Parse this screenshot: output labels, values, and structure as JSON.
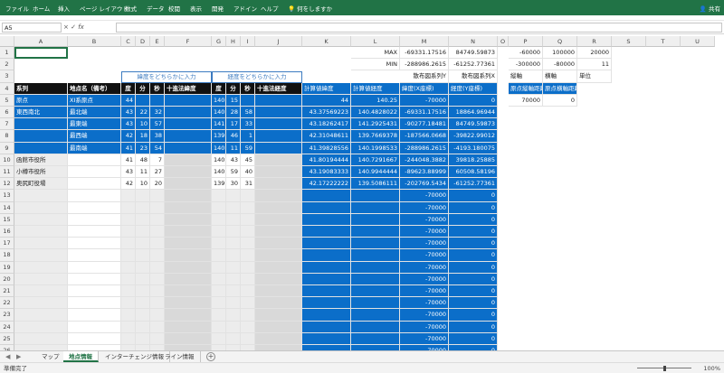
{
  "ribbon": {
    "tabs": [
      "ファイル",
      "ホーム",
      "挿入",
      "ページ レイアウト",
      "数式",
      "データ",
      "校閲",
      "表示",
      "開発",
      "アドイン",
      "ヘルプ"
    ],
    "help_text": "何をしますか",
    "share": "共有"
  },
  "formula_bar": {
    "name_box": "A5",
    "fx": "fx",
    "value": ""
  },
  "columns": [
    "A",
    "B",
    "C",
    "D",
    "E",
    "F",
    "G",
    "H",
    "I",
    "J",
    "K",
    "L",
    "M",
    "N",
    "O",
    "P",
    "Q",
    "R",
    "S",
    "T",
    "U"
  ],
  "rows": [
    "1",
    "2",
    "3",
    "4",
    "5",
    "6",
    "7",
    "8",
    "9",
    "10",
    "11",
    "12",
    "13",
    "14",
    "15",
    "16",
    "17",
    "18",
    "19",
    "20",
    "21",
    "22",
    "23",
    "24",
    "25",
    "26",
    "27"
  ],
  "labels": {
    "lat_input": "緯度をどちらかに入力",
    "lon_input": "経度をどちらかに入力",
    "max": "MAX",
    "min": "MIN",
    "y_label": "散布図系列Y",
    "x_label": "散布図系列X",
    "vertical_axis": "縦軸",
    "horizontal_axis": "横軸",
    "unit": "単位"
  },
  "summary": {
    "max_m": "-69331.17516",
    "max_n": "84749.59873",
    "min_m": "-288986.2615",
    "min_n": "-61252.77361",
    "p1": "-60000",
    "q1": "100000",
    "r1": "20000",
    "p2": "-300000",
    "q2": "-80000",
    "r2": "11"
  },
  "headers": [
    "系列",
    "地点名（備考）",
    "度",
    "分",
    "秒",
    "十進法緯度",
    "度",
    "分",
    "秒",
    "十進法経度",
    "計算値緯度",
    "計算値経度",
    "緯度(X座標)",
    "経度(Y座標)",
    "原点縦軸距離",
    "原点横軸距離"
  ],
  "origin_values": {
    "p": "70000",
    "q": "0"
  },
  "data_rows": [
    {
      "a": "原点",
      "b": "XI系原点",
      "c": "44",
      "d": "",
      "e": "",
      "f": "",
      "g": "140",
      "h": "15",
      "i": "",
      "j": "",
      "k": "44",
      "l": "140.25",
      "m": "-70000",
      "n": "0"
    },
    {
      "a": "東西南北",
      "b": "最北端",
      "c": "43",
      "d": "22",
      "e": "32",
      "f": "",
      "g": "140",
      "h": "28",
      "i": "58",
      "j": "",
      "k": "43.37569223",
      "l": "140.4828022",
      "m": "-69331.17516",
      "n": "18864.96944"
    },
    {
      "a": "",
      "b": "最東端",
      "c": "43",
      "d": "10",
      "e": "57",
      "f": "",
      "g": "141",
      "h": "17",
      "i": "33",
      "j": "",
      "k": "43.18262417",
      "l": "141.2925431",
      "m": "-90277.18481",
      "n": "84749.59873"
    },
    {
      "a": "",
      "b": "最西端",
      "c": "42",
      "d": "18",
      "e": "38",
      "f": "",
      "g": "139",
      "h": "46",
      "i": "1",
      "j": "",
      "k": "42.31048611",
      "l": "139.7669378",
      "m": "-187566.0668",
      "n": "-39822.99012"
    },
    {
      "a": "",
      "b": "最南端",
      "c": "41",
      "d": "23",
      "e": "54",
      "f": "",
      "g": "140",
      "h": "11",
      "i": "59",
      "j": "",
      "k": "41.39828556",
      "l": "140.1998533",
      "m": "-288986.2615",
      "n": "-4193.180075"
    },
    {
      "a": "函館市役所",
      "b": "",
      "c": "41",
      "d": "48",
      "e": "7",
      "f": "",
      "g": "140",
      "h": "43",
      "i": "45",
      "j": "",
      "k": "41.80194444",
      "l": "140.7291667",
      "m": "-244048.3882",
      "n": "39818.25885"
    },
    {
      "a": "小樽市役所",
      "b": "",
      "c": "43",
      "d": "11",
      "e": "27",
      "f": "",
      "g": "140",
      "h": "59",
      "i": "40",
      "j": "",
      "k": "43.19083333",
      "l": "140.9944444",
      "m": "-89623.88999",
      "n": "60508.58196"
    },
    {
      "a": "奥尻町役場",
      "b": "",
      "c": "42",
      "d": "10",
      "e": "20",
      "f": "",
      "g": "139",
      "h": "30",
      "i": "31",
      "j": "",
      "k": "42.17222222",
      "l": "139.5086111",
      "m": "-202769.5434",
      "n": "-61252.77361"
    }
  ],
  "empty_m": "-70000",
  "empty_n": "0",
  "sheets": [
    "マップ",
    "地点情報",
    "インターチェンジ情報",
    "ライン情報"
  ],
  "active_sheet": 1,
  "status": {
    "ready": "準備完了",
    "zoom": "100%"
  }
}
